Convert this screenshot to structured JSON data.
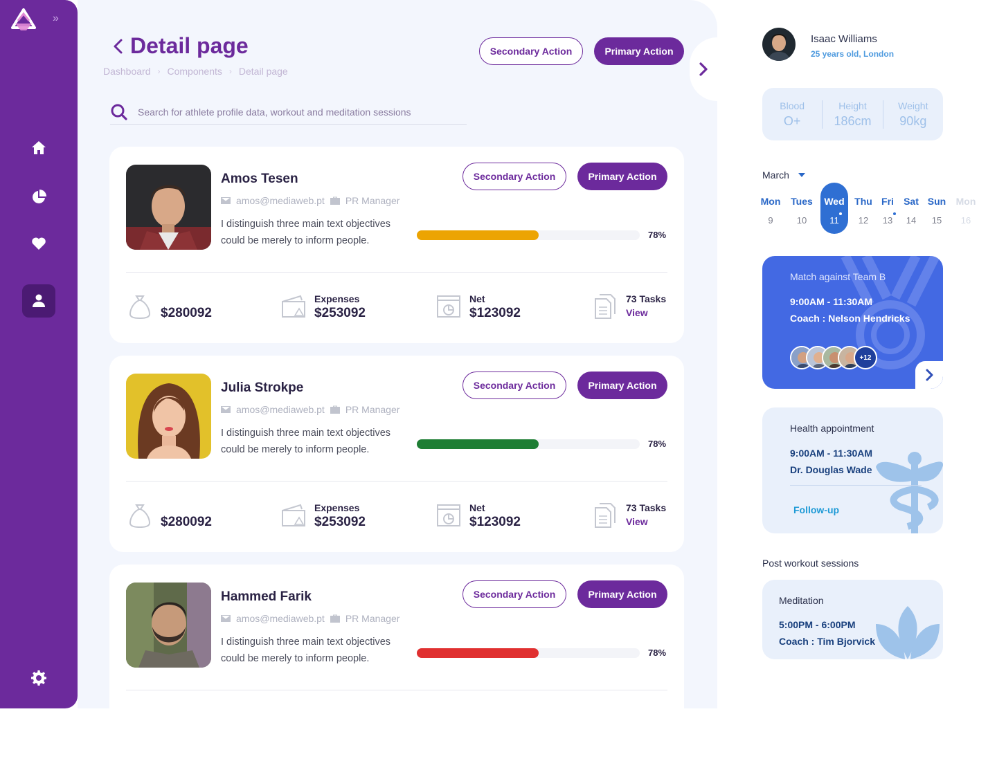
{
  "page": {
    "title": "Detail page",
    "breadcrumb": [
      "Dashboard",
      "Components",
      "Detail page"
    ],
    "secondary_action": "Secondary Action",
    "primary_action": "Primary Action",
    "search_placeholder": "Search for athlete profile data, workout and meditation sessions"
  },
  "sidebar": {
    "items": [
      {
        "icon": "home-icon",
        "active": false
      },
      {
        "icon": "pie-chart-icon",
        "active": false
      },
      {
        "icon": "heart-icon",
        "active": false
      },
      {
        "icon": "user-icon",
        "active": true
      }
    ],
    "settings_icon": "gear-icon"
  },
  "athletes": [
    {
      "name": "Amos Tesen",
      "email": "amos@mediaweb.pt",
      "role": "PR Manager",
      "description": "I distinguish three main text objectives could be merely to inform people.",
      "progress_percent": 78,
      "progress_label": "78%",
      "progress_color": "#eca402",
      "secondary_action": "Secondary Action",
      "primary_action": "Primary Action",
      "income_value": "$280092",
      "expenses_label": "Expenses",
      "expenses_value": "$253092",
      "net_label": "Net",
      "net_value": "$123092",
      "tasks_label": "73 Tasks",
      "tasks_link": "View"
    },
    {
      "name": "Julia Strokpe",
      "email": "amos@mediaweb.pt",
      "role": "PR Manager",
      "description": "I distinguish three main text objectives could be merely to inform people.",
      "progress_percent": 78,
      "progress_label": "78%",
      "progress_color": "#1e7e34",
      "secondary_action": "Secondary Action",
      "primary_action": "Primary Action",
      "income_value": "$280092",
      "expenses_label": "Expenses",
      "expenses_value": "$253092",
      "net_label": "Net",
      "net_value": "$123092",
      "tasks_label": "73 Tasks",
      "tasks_link": "View"
    },
    {
      "name": "Hammed Farik",
      "email": "amos@mediaweb.pt",
      "role": "PR Manager",
      "description": "I distinguish three main text objectives could be merely to inform people.",
      "progress_percent": 78,
      "progress_label": "78%",
      "progress_color": "#e03030",
      "secondary_action": "Secondary Action",
      "primary_action": "Primary Action"
    }
  ],
  "profile": {
    "name": "Isaac Williams",
    "subtitle": "25 years old, London",
    "vitals": [
      {
        "label": "Blood",
        "value": "O+"
      },
      {
        "label": "Height",
        "value": "186cm"
      },
      {
        "label": "Weight",
        "value": "90kg"
      }
    ]
  },
  "calendar": {
    "month": "March",
    "days": [
      {
        "name": "Mon",
        "date": "9"
      },
      {
        "name": "Tues",
        "date": "10"
      },
      {
        "name": "Wed",
        "date": "11"
      },
      {
        "name": "Thu",
        "date": "12"
      },
      {
        "name": "Fri",
        "date": "13"
      },
      {
        "name": "Sat",
        "date": "14"
      },
      {
        "name": "Sun",
        "date": "15"
      },
      {
        "name": "Mon",
        "date": "16"
      }
    ]
  },
  "events": {
    "match": {
      "title": "Match against Team B",
      "time": "9:00AM - 11:30AM",
      "who": "Coach : Nelson Hendricks",
      "more": "+12"
    },
    "health": {
      "title": "Health appointment",
      "time": "9:00AM - 11:30AM",
      "who": "Dr. Douglas Wade",
      "link": "Follow-up"
    },
    "section_label": "Post workout sessions",
    "meditation": {
      "title": "Meditation",
      "time": "5:00PM - 6:00PM",
      "who": "Coach : Tim Bjorvick"
    }
  },
  "colors": {
    "brand": "#6c2a9c",
    "accent_blue": "#4369e3",
    "panel_bg": "#f3f6fd"
  }
}
